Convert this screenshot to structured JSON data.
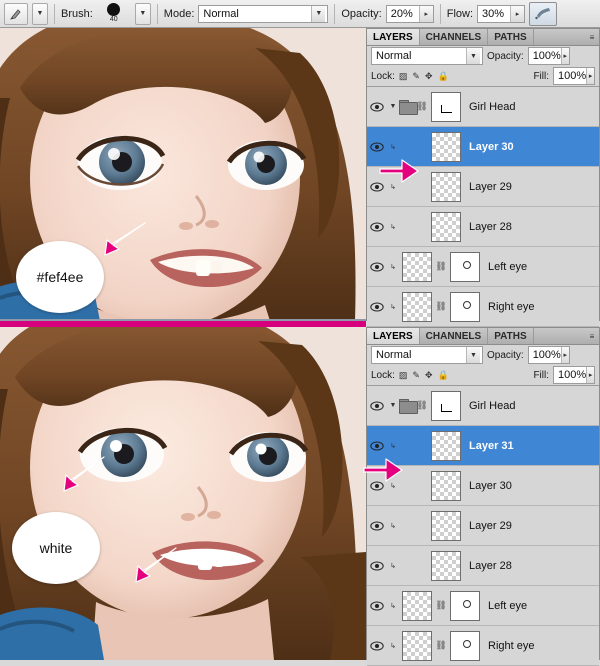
{
  "toolbar": {
    "tool_icon": "brush-tool-icon",
    "preset_arrow": "chevron-down-icon",
    "brush_label": "Brush:",
    "brush_size": "40",
    "mode_label": "Mode:",
    "mode_value": "Normal",
    "opacity_label": "Opacity:",
    "opacity_value": "20%",
    "flow_label": "Flow:",
    "flow_value": "30%",
    "airbrush_icon": "airbrush-icon"
  },
  "photo_top": {
    "callout_text": "#fef4ee",
    "arrow_icon": "pink-arrow-icon"
  },
  "photo_bottom": {
    "callout_text": "white",
    "arrow_icon_cheek": "pink-arrow-icon",
    "arrow_icon_tooth": "pink-arrow-icon"
  },
  "panel_top": {
    "tabs": [
      {
        "label": "LAYERS",
        "active": true
      },
      {
        "label": "CHANNELS",
        "active": false
      },
      {
        "label": "PATHS",
        "active": false
      }
    ],
    "tab_menu_icon": "panel-menu-icon",
    "blend_mode": "Normal",
    "opacity_label": "Opacity:",
    "opacity_value": "100%",
    "lock_label": "Lock:",
    "lock_icons": [
      "transparency-lock-icon",
      "brush-lock-icon",
      "move-lock-icon",
      "all-lock-icon"
    ],
    "fill_label": "Fill:",
    "fill_value": "100%",
    "layers": [
      {
        "name": "Girl Head",
        "type": "group",
        "selected": false,
        "has_mask": true,
        "has_link": true,
        "thumb": "white"
      },
      {
        "name": "Layer 30",
        "type": "layer",
        "selected": true,
        "indented": true,
        "thumb": "transparent"
      },
      {
        "name": "Layer 29",
        "type": "layer",
        "selected": false,
        "indented": true,
        "thumb": "transparent"
      },
      {
        "name": "Layer 28",
        "type": "layer",
        "selected": false,
        "indented": true,
        "thumb": "transparent"
      },
      {
        "name": "Left eye",
        "type": "layer",
        "selected": false,
        "indented": true,
        "has_mask": true,
        "has_link": true,
        "thumb": "transparent"
      },
      {
        "name": "Right eye",
        "type": "layer",
        "selected": false,
        "indented": true,
        "has_mask": true,
        "has_link": true,
        "thumb": "transparent"
      }
    ],
    "selection_arrow_icon": "pink-arrow-icon"
  },
  "panel_bottom": {
    "tabs": [
      {
        "label": "LAYERS",
        "active": true
      },
      {
        "label": "CHANNELS",
        "active": false
      },
      {
        "label": "PATHS",
        "active": false
      }
    ],
    "tab_menu_icon": "panel-menu-icon",
    "blend_mode": "Normal",
    "opacity_label": "Opacity:",
    "opacity_value": "100%",
    "lock_label": "Lock:",
    "lock_icons": [
      "transparency-lock-icon",
      "brush-lock-icon",
      "move-lock-icon",
      "all-lock-icon"
    ],
    "fill_label": "Fill:",
    "fill_value": "100%",
    "layers": [
      {
        "name": "Girl Head",
        "type": "group",
        "selected": false,
        "has_mask": true,
        "has_link": true,
        "thumb": "white"
      },
      {
        "name": "Layer 31",
        "type": "layer",
        "selected": true,
        "indented": true,
        "thumb": "transparent"
      },
      {
        "name": "Layer 30",
        "type": "layer",
        "selected": false,
        "indented": true,
        "thumb": "transparent"
      },
      {
        "name": "Layer 29",
        "type": "layer",
        "selected": false,
        "indented": true,
        "thumb": "transparent"
      },
      {
        "name": "Layer 28",
        "type": "layer",
        "selected": false,
        "indented": true,
        "thumb": "transparent"
      },
      {
        "name": "Left eye",
        "type": "layer",
        "selected": false,
        "indented": true,
        "has_mask": true,
        "has_link": true,
        "thumb": "transparent"
      },
      {
        "name": "Right eye",
        "type": "layer",
        "selected": false,
        "indented": true,
        "has_mask": true,
        "has_link": true,
        "thumb": "transparent"
      }
    ],
    "selection_arrow_icon": "pink-arrow-icon"
  },
  "colors": {
    "selection_blue": "#3f86d4",
    "divider_pink": "#d6007f",
    "arrow_pink": "#e5007e",
    "panel_gray": "#d6d6d6"
  }
}
